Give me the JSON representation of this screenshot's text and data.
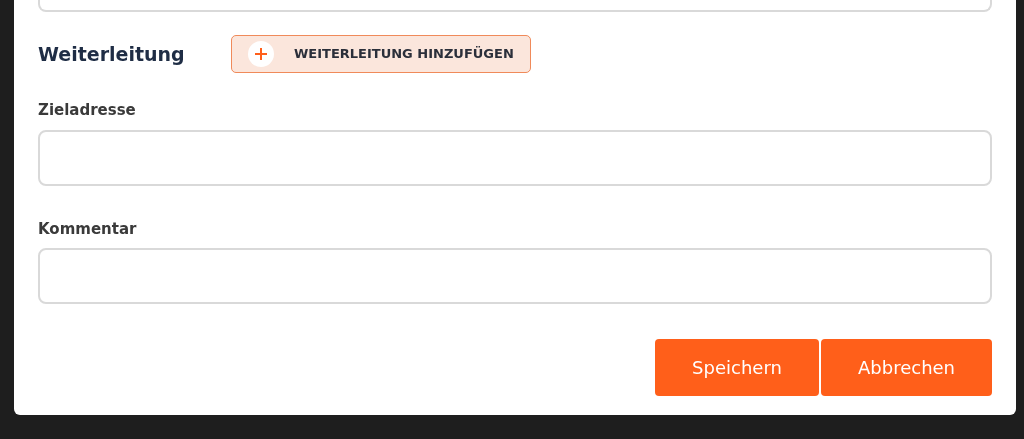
{
  "forwarding": {
    "title": "Weiterleitung",
    "add_button": "WEITERLEITUNG HINZUFÜGEN"
  },
  "fields": [
    {
      "label": "Zieladresse"
    },
    {
      "label": "Kommentar"
    }
  ],
  "buttons": [
    {
      "label": "Speichern"
    },
    {
      "label": "Abbrechen"
    }
  ]
}
